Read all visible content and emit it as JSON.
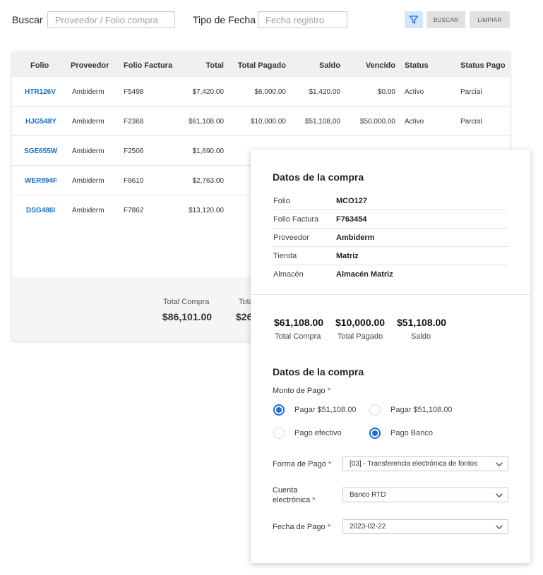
{
  "search": {
    "buscar_label": "Buscar",
    "buscar_placeholder": "Proveedor / Folio compra",
    "tipo_label": "Tipo de Fecha",
    "tipo_placeholder": "Fecha registro",
    "buscar_button": "BUSCAR",
    "limpiar_button": "LIMPIAR",
    "filter_icon": "filter-icon"
  },
  "table": {
    "headers": {
      "folio": "Folio",
      "proveedor": "Proveedor",
      "folio_factura": "Folio Factura",
      "total": "Total",
      "total_pagado": "Total Pagado",
      "saldo": "Saldo",
      "vencido": "Vencido",
      "status": "Status",
      "status_pago": "Status Pago"
    },
    "rows": [
      {
        "folio": "HTR126V",
        "proveedor": "Ambiderm",
        "folio_factura": "F5498",
        "total": "$7,420.00",
        "total_pagado": "$6,000.00",
        "saldo": "$1,420.00",
        "vencido": "$0.00",
        "status": "Activo",
        "status_pago": "Parcial"
      },
      {
        "folio": "HJG548Y",
        "proveedor": "Ambiderm",
        "folio_factura": "F2368",
        "total": "$61,108.00",
        "total_pagado": "$10,000.00",
        "saldo": "$51,108.00",
        "vencido": "$50,000.00",
        "status": "Activo",
        "status_pago": "Parcial"
      },
      {
        "folio": "SGE655W",
        "proveedor": "Ambiderm",
        "folio_factura": "F2506",
        "total": "$1,690.00"
      },
      {
        "folio": "WER894F",
        "proveedor": "Ambiderm",
        "folio_factura": "F8610",
        "total": "$2,763.00"
      },
      {
        "folio": "DSG486I",
        "proveedor": "Ambiderm",
        "folio_factura": "F7862",
        "total": "$13,120.00"
      }
    ],
    "footer": {
      "total_compra_label": "Total Compra",
      "total_compra_value": "$86,101.00",
      "partial_label": "Tota",
      "partial_value": "$26"
    }
  },
  "modal": {
    "title": "Datos de la compra",
    "info": [
      {
        "key": "Folio",
        "value": "MCO127"
      },
      {
        "key": "Folio Factura",
        "value": "F763454"
      },
      {
        "key": "Proveedor",
        "value": "Ambiderm"
      },
      {
        "key": "Tienda",
        "value": "Matriz"
      },
      {
        "key": "Almacén",
        "value": "Almacén Matriz"
      }
    ],
    "totals": [
      {
        "value": "$61,108.00",
        "label": "Total Compra"
      },
      {
        "value": "$10,000.00",
        "label": "Total Pagado"
      },
      {
        "value": "$51,108.00",
        "label": "Saldo"
      }
    ],
    "payment_title": "Datos de la compra",
    "monto_label": "Monto de Pago",
    "required_mark": "*",
    "radios": [
      {
        "label": "Pagar $51,108.00",
        "checked": true
      },
      {
        "label": "Pagar $51,108.00",
        "checked": false
      },
      {
        "label": "Pago efectivo",
        "checked": false
      },
      {
        "label": "Pago Banco",
        "checked": true
      }
    ],
    "forma_label": "Forma de Pago",
    "forma_value": "[03] - Transferencia electrónica de fontos",
    "cuenta_label_1": "Cuenta",
    "cuenta_label_2": "electrónica",
    "cuenta_value": "Banco RTD",
    "fecha_label": "Fecha de Pago",
    "fecha_value": "2023-02-22"
  },
  "colors": {
    "accent": "#1a6fcf",
    "required": "#d32f2f",
    "header_bg": "#eef0f2",
    "filter_bg": "#d4e6fb"
  }
}
